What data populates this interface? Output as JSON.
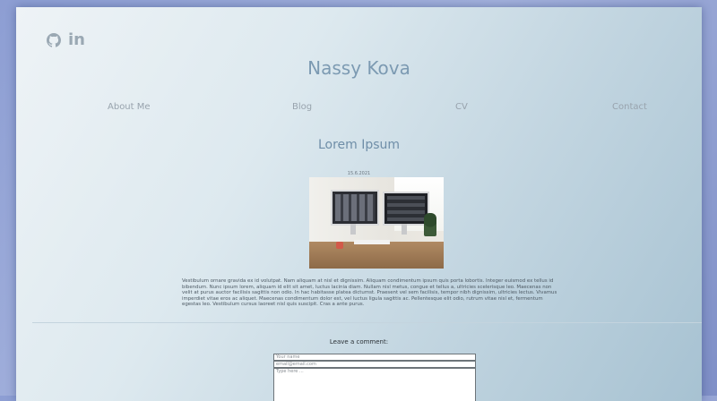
{
  "social": {
    "github_icon": "github-icon",
    "linkedin_label": "in"
  },
  "site": {
    "title": "Nassy Kova"
  },
  "nav": {
    "items": [
      {
        "label": "About Me"
      },
      {
        "label": "Blog"
      },
      {
        "label": "CV"
      },
      {
        "label": "Contact"
      }
    ]
  },
  "post": {
    "title": "Lorem Ipsum",
    "date": "15.6.2021",
    "image_alt": "desk with two monitors",
    "body": "Vestibulum ornare gravida ex id volutpat. Nam aliquam at nisl et dignissim. Aliquam condimentum ipsum quis porta lobortis. Integer euismod ex tellus id bibendum. Nunc ipsum lorem, aliquam id elit sit amet, luctus lacinia diam. Nullam nisl metus, congue et tellus a, ultricies scelerisque leo. Maecenas non velit at purus auctor facilisis sagittis non odio. In hac habitasse platea dictumst. Praesent vel sem facilisis, tempor nibh dignissim, ultricies lectus. Vivamus imperdiet vitae eros ac aliquet. Maecenas condimentum dolor est, vel luctus ligula sagittis ac. Pellentesque elit odio, rutrum vitae nisl et, fermentum egestas leo. Vestibulum cursus laoreet nisl quis suscipit. Cras a ante purus."
  },
  "comments": {
    "heading": "Leave a comment:",
    "name_placeholder": "Your name",
    "email_placeholder": "email@email.com",
    "text_placeholder": "Type here ..."
  }
}
